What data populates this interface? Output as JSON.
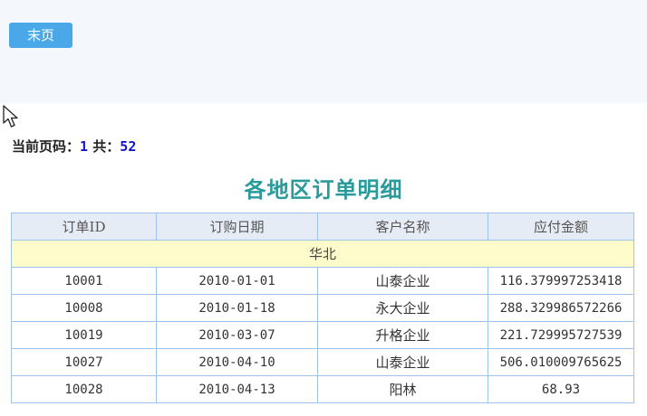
{
  "toolbar": {
    "last_page_label": "末页"
  },
  "pagination": {
    "current_label": "当前页码：",
    "current_page": "1",
    "total_label": "共：",
    "total_pages": "52"
  },
  "report": {
    "title": "各地区订单明细",
    "columns": [
      "订单ID",
      "订购日期",
      "客户名称",
      "应付金额"
    ],
    "group_label": "华北",
    "rows": [
      [
        "10001",
        "2010-01-01",
        "山泰企业",
        "116.379997253418"
      ],
      [
        "10008",
        "2010-01-18",
        "永大企业",
        "288.329986572266"
      ],
      [
        "10019",
        "2010-03-07",
        "升格企业",
        "221.729995727539"
      ],
      [
        "10027",
        "2010-04-10",
        "山泰企业",
        "506.010009765625"
      ],
      [
        "10028",
        "2010-04-13",
        "阳林",
        "68.93"
      ]
    ]
  },
  "colors": {
    "button": "#4aa8e8",
    "title": "#2a9a9a",
    "page_number": "#1515c8",
    "header_bg": "#e6ecf5",
    "group_bg": "#fffccc",
    "border": "#9dc3ea"
  },
  "icons": {
    "cursor": "mouse-pointer-icon"
  }
}
